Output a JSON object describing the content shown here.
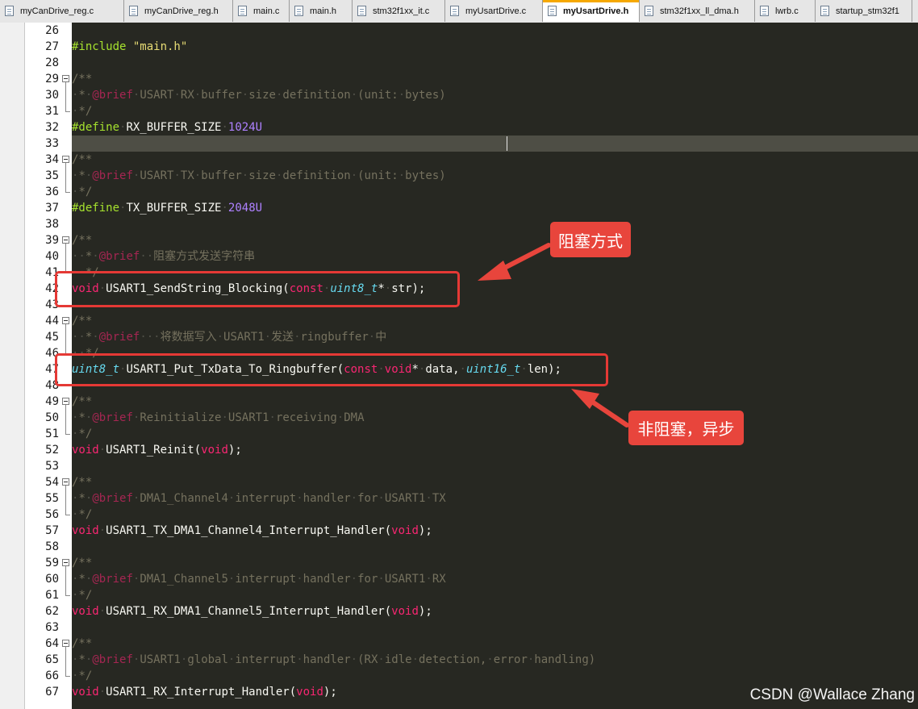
{
  "tabs": [
    {
      "label": "myCanDrive_reg.c",
      "active": false
    },
    {
      "label": "myCanDrive_reg.h",
      "active": false
    },
    {
      "label": "main.c",
      "active": false
    },
    {
      "label": "main.h",
      "active": false
    },
    {
      "label": "stm32f1xx_it.c",
      "active": false
    },
    {
      "label": "myUsartDrive.c",
      "active": false
    },
    {
      "label": "myUsartDrive.h",
      "active": true
    },
    {
      "label": "stm32f1xx_ll_dma.h",
      "active": false
    },
    {
      "label": "lwrb.c",
      "active": false
    },
    {
      "label": "startup_stm32f1",
      "active": false
    }
  ],
  "lines": [
    {
      "n": "26",
      "t": []
    },
    {
      "n": "27",
      "t": [
        [
          "pp",
          "#include "
        ],
        [
          "str",
          "\"main.h\""
        ]
      ]
    },
    {
      "n": "28",
      "t": []
    },
    {
      "n": "29",
      "t": [
        [
          "cm",
          "/**"
        ]
      ]
    },
    {
      "n": "30",
      "t": [
        [
          "dt",
          "·"
        ],
        [
          "cm",
          "*"
        ],
        [
          "dt",
          "·"
        ],
        [
          "kwc",
          "@brief"
        ],
        [
          "dt",
          "·"
        ],
        [
          "cm",
          "USART"
        ],
        [
          "dt",
          "·"
        ],
        [
          "cm",
          "RX"
        ],
        [
          "dt",
          "·"
        ],
        [
          "cm",
          "buffer"
        ],
        [
          "dt",
          "·"
        ],
        [
          "cm",
          "size"
        ],
        [
          "dt",
          "·"
        ],
        [
          "cm",
          "definition"
        ],
        [
          "dt",
          "·"
        ],
        [
          "cm",
          "(unit:"
        ],
        [
          "dt",
          "·"
        ],
        [
          "cm",
          "bytes)"
        ]
      ]
    },
    {
      "n": "31",
      "t": [
        [
          "dt",
          "·"
        ],
        [
          "cm",
          "*/"
        ]
      ]
    },
    {
      "n": "32",
      "t": [
        [
          "pp",
          "#define"
        ],
        [
          "dt",
          "·"
        ],
        [
          "p",
          "RX_BUFFER_SIZE"
        ],
        [
          "dt",
          "·"
        ],
        [
          "num",
          "1024U"
        ]
      ]
    },
    {
      "n": "33",
      "t": []
    },
    {
      "n": "34",
      "t": [
        [
          "cm",
          "/**"
        ]
      ]
    },
    {
      "n": "35",
      "t": [
        [
          "dt",
          "·"
        ],
        [
          "cm",
          "*"
        ],
        [
          "dt",
          "·"
        ],
        [
          "kwc",
          "@brief"
        ],
        [
          "dt",
          "·"
        ],
        [
          "cm",
          "USART"
        ],
        [
          "dt",
          "·"
        ],
        [
          "cm",
          "TX"
        ],
        [
          "dt",
          "·"
        ],
        [
          "cm",
          "buffer"
        ],
        [
          "dt",
          "·"
        ],
        [
          "cm",
          "size"
        ],
        [
          "dt",
          "·"
        ],
        [
          "cm",
          "definition"
        ],
        [
          "dt",
          "·"
        ],
        [
          "cm",
          "(unit:"
        ],
        [
          "dt",
          "·"
        ],
        [
          "cm",
          "bytes)"
        ]
      ]
    },
    {
      "n": "36",
      "t": [
        [
          "dt",
          "·"
        ],
        [
          "cm",
          "*/"
        ]
      ]
    },
    {
      "n": "37",
      "t": [
        [
          "pp",
          "#define"
        ],
        [
          "dt",
          "·"
        ],
        [
          "p",
          "TX_BUFFER_SIZE"
        ],
        [
          "dt",
          "·"
        ],
        [
          "num",
          "2048U"
        ]
      ]
    },
    {
      "n": "38",
      "t": []
    },
    {
      "n": "39",
      "t": [
        [
          "cm",
          "/**"
        ]
      ]
    },
    {
      "n": "40",
      "t": [
        [
          "dt",
          "··"
        ],
        [
          "cm",
          "*"
        ],
        [
          "dt",
          "·"
        ],
        [
          "kwc",
          "@brief"
        ],
        [
          "dt",
          "··"
        ],
        [
          "cm",
          "阻塞方式发送字符串"
        ]
      ]
    },
    {
      "n": "41",
      "t": [
        [
          "dt",
          "··"
        ],
        [
          "cm",
          "*/"
        ]
      ]
    },
    {
      "n": "42",
      "t": [
        [
          "kw",
          "void"
        ],
        [
          "dt",
          "·"
        ],
        [
          "p",
          "USART1_SendString_Blocking("
        ],
        [
          "kw",
          "const"
        ],
        [
          "dt",
          "·"
        ],
        [
          "ty",
          "uint8_t"
        ],
        [
          "p",
          "*"
        ],
        [
          "dt",
          "·"
        ],
        [
          "p",
          "str);"
        ]
      ]
    },
    {
      "n": "43",
      "t": []
    },
    {
      "n": "44",
      "t": [
        [
          "cm",
          "/**"
        ]
      ]
    },
    {
      "n": "45",
      "t": [
        [
          "dt",
          "··"
        ],
        [
          "cm",
          "*"
        ],
        [
          "dt",
          "·"
        ],
        [
          "kwc",
          "@brief"
        ],
        [
          "dt",
          "···"
        ],
        [
          "cm",
          "将数据写入"
        ],
        [
          "dt",
          "·"
        ],
        [
          "cm",
          "USART1"
        ],
        [
          "dt",
          "·"
        ],
        [
          "cm",
          "发送"
        ],
        [
          "dt",
          "·"
        ],
        [
          "cm",
          "ringbuffer"
        ],
        [
          "dt",
          "·"
        ],
        [
          "cm",
          "中"
        ]
      ]
    },
    {
      "n": "46",
      "t": [
        [
          "dt",
          "··"
        ],
        [
          "cm",
          "*/"
        ]
      ]
    },
    {
      "n": "47",
      "t": [
        [
          "ty",
          "uint8_t"
        ],
        [
          "dt",
          "·"
        ],
        [
          "p",
          "USART1_Put_TxData_To_Ringbuffer("
        ],
        [
          "kw",
          "const"
        ],
        [
          "dt",
          "·"
        ],
        [
          "kw",
          "void"
        ],
        [
          "p",
          "*"
        ],
        [
          "dt",
          "·"
        ],
        [
          "p",
          "data,"
        ],
        [
          "dt",
          "·"
        ],
        [
          "ty",
          "uint16_t"
        ],
        [
          "dt",
          "·"
        ],
        [
          "p",
          "len);"
        ]
      ]
    },
    {
      "n": "48",
      "t": []
    },
    {
      "n": "49",
      "t": [
        [
          "cm",
          "/**"
        ]
      ]
    },
    {
      "n": "50",
      "t": [
        [
          "dt",
          "·"
        ],
        [
          "cm",
          "*"
        ],
        [
          "dt",
          "·"
        ],
        [
          "kwc",
          "@brief"
        ],
        [
          "dt",
          "·"
        ],
        [
          "cm",
          "Reinitialize"
        ],
        [
          "dt",
          "·"
        ],
        [
          "cm",
          "USART1"
        ],
        [
          "dt",
          "·"
        ],
        [
          "cm",
          "receiving"
        ],
        [
          "dt",
          "·"
        ],
        [
          "cm",
          "DMA"
        ]
      ]
    },
    {
      "n": "51",
      "t": [
        [
          "dt",
          "·"
        ],
        [
          "cm",
          "*/"
        ]
      ]
    },
    {
      "n": "52",
      "t": [
        [
          "kw",
          "void"
        ],
        [
          "dt",
          "·"
        ],
        [
          "p",
          "USART1_Reinit("
        ],
        [
          "kw",
          "void"
        ],
        [
          "p",
          ");"
        ]
      ]
    },
    {
      "n": "53",
      "t": []
    },
    {
      "n": "54",
      "t": [
        [
          "cm",
          "/**"
        ]
      ]
    },
    {
      "n": "55",
      "t": [
        [
          "dt",
          "·"
        ],
        [
          "cm",
          "*"
        ],
        [
          "dt",
          "·"
        ],
        [
          "kwc",
          "@brief"
        ],
        [
          "dt",
          "·"
        ],
        [
          "cm",
          "DMA1_Channel4"
        ],
        [
          "dt",
          "·"
        ],
        [
          "cm",
          "interrupt"
        ],
        [
          "dt",
          "·"
        ],
        [
          "cm",
          "handler"
        ],
        [
          "dt",
          "·"
        ],
        [
          "cm",
          "for"
        ],
        [
          "dt",
          "·"
        ],
        [
          "cm",
          "USART1"
        ],
        [
          "dt",
          "·"
        ],
        [
          "cm",
          "TX"
        ]
      ]
    },
    {
      "n": "56",
      "t": [
        [
          "dt",
          "·"
        ],
        [
          "cm",
          "*/"
        ]
      ]
    },
    {
      "n": "57",
      "t": [
        [
          "kw",
          "void"
        ],
        [
          "dt",
          "·"
        ],
        [
          "p",
          "USART1_TX_DMA1_Channel4_Interrupt_Handler("
        ],
        [
          "kw",
          "void"
        ],
        [
          "p",
          ");"
        ]
      ]
    },
    {
      "n": "58",
      "t": []
    },
    {
      "n": "59",
      "t": [
        [
          "cm",
          "/**"
        ]
      ]
    },
    {
      "n": "60",
      "t": [
        [
          "dt",
          "·"
        ],
        [
          "cm",
          "*"
        ],
        [
          "dt",
          "·"
        ],
        [
          "kwc",
          "@brief"
        ],
        [
          "dt",
          "·"
        ],
        [
          "cm",
          "DMA1_Channel5"
        ],
        [
          "dt",
          "·"
        ],
        [
          "cm",
          "interrupt"
        ],
        [
          "dt",
          "·"
        ],
        [
          "cm",
          "handler"
        ],
        [
          "dt",
          "·"
        ],
        [
          "cm",
          "for"
        ],
        [
          "dt",
          "·"
        ],
        [
          "cm",
          "USART1"
        ],
        [
          "dt",
          "·"
        ],
        [
          "cm",
          "RX"
        ]
      ]
    },
    {
      "n": "61",
      "t": [
        [
          "dt",
          "·"
        ],
        [
          "cm",
          "*/"
        ]
      ]
    },
    {
      "n": "62",
      "t": [
        [
          "kw",
          "void"
        ],
        [
          "dt",
          "·"
        ],
        [
          "p",
          "USART1_RX_DMA1_Channel5_Interrupt_Handler("
        ],
        [
          "kw",
          "void"
        ],
        [
          "p",
          ");"
        ]
      ]
    },
    {
      "n": "63",
      "t": []
    },
    {
      "n": "64",
      "t": [
        [
          "cm",
          "/**"
        ]
      ]
    },
    {
      "n": "65",
      "t": [
        [
          "dt",
          "·"
        ],
        [
          "cm",
          "*"
        ],
        [
          "dt",
          "·"
        ],
        [
          "kwc",
          "@brief"
        ],
        [
          "dt",
          "·"
        ],
        [
          "cm",
          "USART1"
        ],
        [
          "dt",
          "·"
        ],
        [
          "cm",
          "global"
        ],
        [
          "dt",
          "·"
        ],
        [
          "cm",
          "interrupt"
        ],
        [
          "dt",
          "·"
        ],
        [
          "cm",
          "handler"
        ],
        [
          "dt",
          "·"
        ],
        [
          "cm",
          "(RX"
        ],
        [
          "dt",
          "·"
        ],
        [
          "cm",
          "idle"
        ],
        [
          "dt",
          "·"
        ],
        [
          "cm",
          "detection,"
        ],
        [
          "dt",
          "·"
        ],
        [
          "cm",
          "error"
        ],
        [
          "dt",
          "·"
        ],
        [
          "cm",
          "handling)"
        ]
      ]
    },
    {
      "n": "66",
      "t": [
        [
          "dt",
          "·"
        ],
        [
          "cm",
          "*/"
        ]
      ]
    },
    {
      "n": "67",
      "t": [
        [
          "kw",
          "void"
        ],
        [
          "dt",
          "·"
        ],
        [
          "p",
          "USART1_RX_Interrupt_Handler("
        ],
        [
          "kw",
          "void"
        ],
        [
          "p",
          ");"
        ]
      ]
    }
  ],
  "annotations": {
    "blocking_label": "阻塞方式",
    "nonblocking_label": "非阻塞，异步",
    "box_color": "#e53935"
  },
  "watermark": "CSDN @Wallace Zhang",
  "colors": {
    "editor_bg": "#272822",
    "keyword": "#f92672",
    "type": "#66d9ef",
    "preprocessor": "#a6e22e",
    "string": "#e6db74",
    "number": "#ae81ff",
    "comment": "#75715e"
  }
}
